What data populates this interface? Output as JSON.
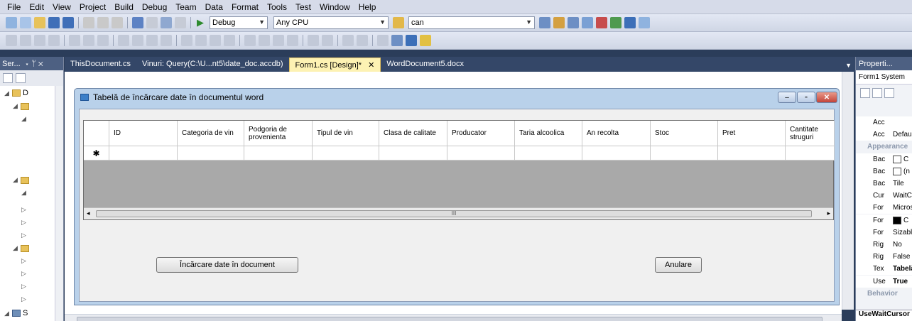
{
  "menu": [
    "File",
    "Edit",
    "View",
    "Project",
    "Build",
    "Debug",
    "Team",
    "Data",
    "Format",
    "Tools",
    "Test",
    "Window",
    "Help"
  ],
  "toolbar": {
    "config": "Debug",
    "platform": "Any CPU",
    "find_text": "can"
  },
  "left_panel": {
    "title": "Ser...",
    "pin": "▾ ᛘ ✕",
    "tree_root": "D"
  },
  "tabs": [
    {
      "label": "ThisDocument.cs",
      "active": false
    },
    {
      "label": "Vinuri: Query(C:\\U...nt5\\date_doc.accdb)",
      "active": false
    },
    {
      "label": "Form1.cs [Design]*",
      "active": true,
      "close": "✕"
    },
    {
      "label": "WordDocument5.docx",
      "active": false
    }
  ],
  "form": {
    "title": "Tabelă de încărcare date în documentul word",
    "minimize": "–",
    "maximize": "▫",
    "close": "✕",
    "grid": {
      "columns": [
        "ID",
        "Categoria de vin",
        "Podgoria de provenienta",
        "Tipul de vin",
        "Clasa de calitate",
        "Producator",
        "Taria alcoolica",
        "An recolta",
        "Stoc",
        "Pret",
        "Cantitate struguri"
      ],
      "new_row_marker": "✱",
      "scroll_marker": "III"
    },
    "load_button": "Încărcare date  în document",
    "cancel_button": "Anulare"
  },
  "designer_scroll_marker": "III",
  "properties": {
    "title": "Properti...",
    "object": "Form1  System",
    "rows": [
      {
        "name": "Acc",
        "value": "",
        "category": false
      },
      {
        "name": "Acc",
        "value": "Defaul",
        "category": false
      },
      {
        "name": "Appearance",
        "value": "",
        "category": true
      },
      {
        "name": "Bac",
        "value": "C",
        "swatch": "#ffffff",
        "category": false
      },
      {
        "name": "Bac",
        "value": "(n",
        "swatch": "#ffffff",
        "category": false
      },
      {
        "name": "Bac",
        "value": "Tile",
        "category": false
      },
      {
        "name": "Cur",
        "value": "WaitC",
        "category": false
      },
      {
        "name": "For",
        "value": "Micros",
        "category": false
      },
      {
        "name": "For",
        "value": "C",
        "swatch": "#000000",
        "category": false
      },
      {
        "name": "For",
        "value": "Sizable",
        "category": false
      },
      {
        "name": "Rig",
        "value": "No",
        "category": false
      },
      {
        "name": "Rig",
        "value": "False",
        "category": false
      },
      {
        "name": "Tex",
        "value": "Tabelă",
        "bold": true,
        "category": false
      },
      {
        "name": "Use",
        "value": "True",
        "bold": true,
        "category": false
      },
      {
        "name": "Behavior",
        "value": "",
        "category": true
      }
    ],
    "footer": "UseWaitCursor"
  }
}
